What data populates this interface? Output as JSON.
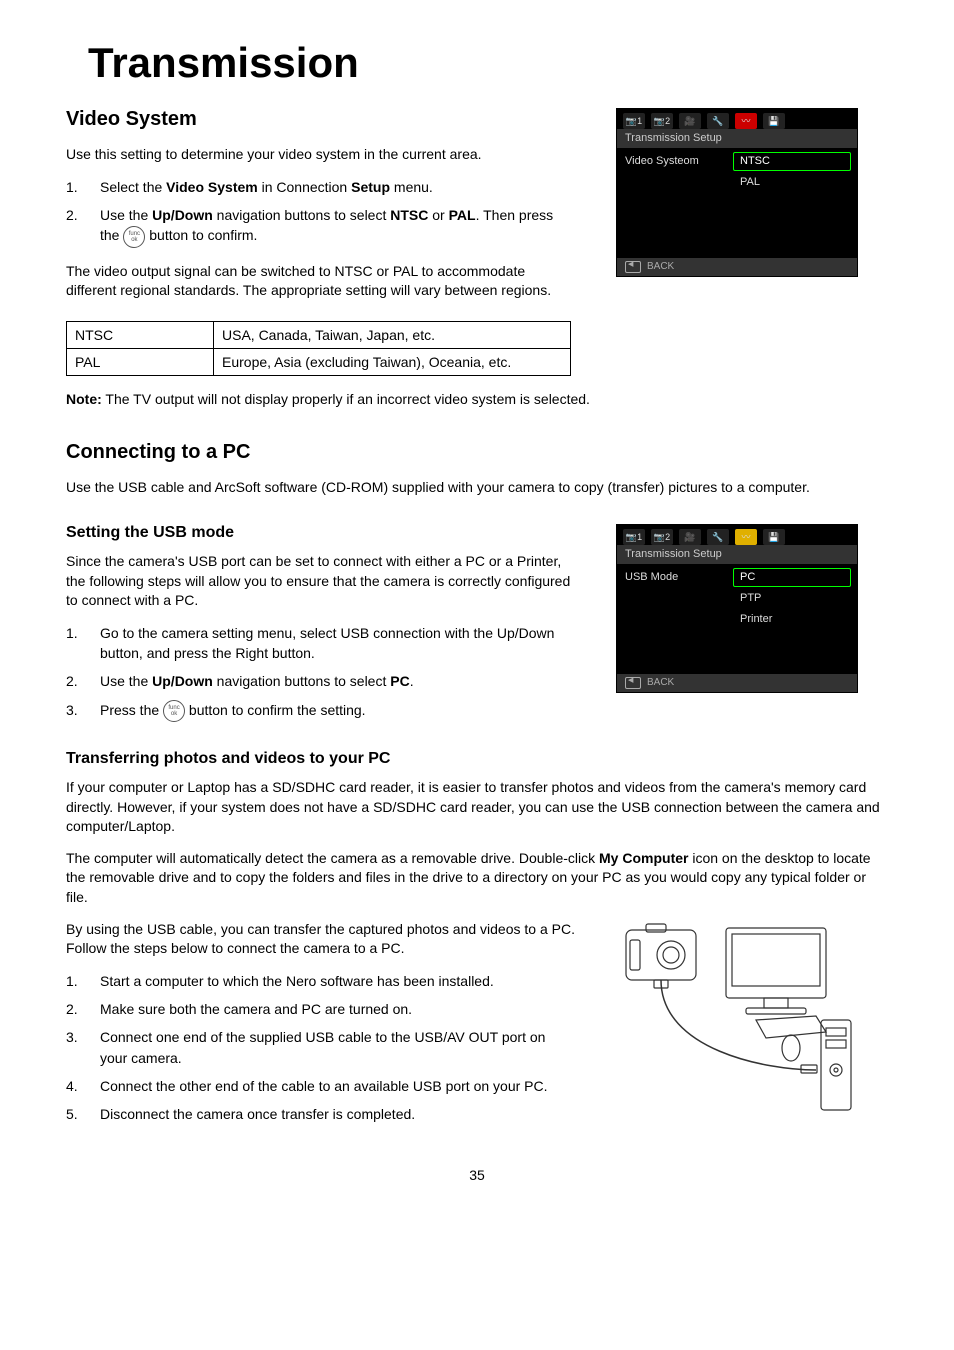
{
  "mainTitle": "Transmission",
  "videoSystem": {
    "title": "Video System",
    "intro": "Use this setting to determine your video system in the current area.",
    "step1_pre": "Select the ",
    "step1_b1": "Video System",
    "step1_mid": " in Connection ",
    "step1_b2": "Setup",
    "step1_post": " menu.",
    "step2_pre": "Use the ",
    "step2_b1": "Up/Down",
    "step2_mid1": " navigation buttons to select ",
    "step2_b2": "NTSC",
    "step2_mid2": " or ",
    "step2_b3": "PAL",
    "step2_post1": ". Then press the ",
    "step2_post2": " button to confirm.",
    "note1": "The video output signal can be switched to NTSC or PAL to accommodate different regional standards. The appropriate setting will vary between regions.",
    "regionTable": {
      "row1": {
        "label": "NTSC",
        "desc": "USA, Canada, Taiwan, Japan, etc."
      },
      "row2": {
        "label": "PAL",
        "desc": "Europe, Asia (excluding Taiwan), Oceania, etc."
      }
    },
    "tvNote_label": "Note:",
    "tvNote_text": "  The TV output will not display properly if an incorrect video system is selected."
  },
  "camUI1": {
    "subheader": "Transmission Setup",
    "leftLabel": "Video Systeom",
    "opt1": "NTSC",
    "opt2": "PAL",
    "back": "BACK",
    "tab1": "1",
    "tab2": "2"
  },
  "connectPC": {
    "title": "Connecting to a PC",
    "intro": "Use the USB cable and ArcSoft software (CD-ROM) supplied with your camera to copy (transfer) pictures to a computer."
  },
  "usbMode": {
    "title": "Setting the USB mode",
    "intro": "Since the camera's USB port can be set to connect with either a PC or a Printer, the following steps will allow you to ensure that the camera is correctly configured to connect with a PC.",
    "step1": "Go to the camera setting menu, select USB connection with the Up/Down button, and press the Right button.",
    "step2_pre": "Use the ",
    "step2_b1": "Up/Down",
    "step2_mid": " navigation buttons to select ",
    "step2_b2": "PC",
    "step2_post": ".",
    "step3_pre": "Press the ",
    "step3_post": " button to confirm the setting."
  },
  "camUI2": {
    "subheader": "Transmission Setup",
    "leftLabel": "USB Mode",
    "opt1": "PC",
    "opt2": "PTP",
    "opt3": "Printer",
    "back": "BACK",
    "tab1": "1",
    "tab2": "2"
  },
  "transfer": {
    "title": "Transferring photos and videos to your PC",
    "p1": "If your computer or Laptop has a SD/SDHC card reader, it is easier to transfer photos and videos from the camera's memory card directly.  However, if your system does not have a SD/SDHC card reader, you can use the USB connection between the camera and computer/Laptop.",
    "p2_pre": "The computer will automatically detect the camera as a removable drive. Double-click ",
    "p2_b": "My Computer",
    "p2_post": " icon on the desktop to locate the removable drive and to copy the folders and files in the drive to a directory on your PC as you would copy any typical folder or file.",
    "p3": "By using the USB cable, you can transfer the captured photos and videos to a PC. Follow the steps below to connect the camera to a PC.",
    "s1": "Start a computer to which the Nero software has been installed.",
    "s2": "Make sure both the camera and PC are turned on.",
    "s3": "Connect one end of the supplied USB cable to the USB/AV OUT port on your camera.",
    "s4": "Connect the other end of the cable to an available USB port on your PC.",
    "s5": "Disconnect the camera once transfer is completed."
  },
  "funcok": {
    "top": "func",
    "bot": "ok"
  },
  "pageNum": "35"
}
